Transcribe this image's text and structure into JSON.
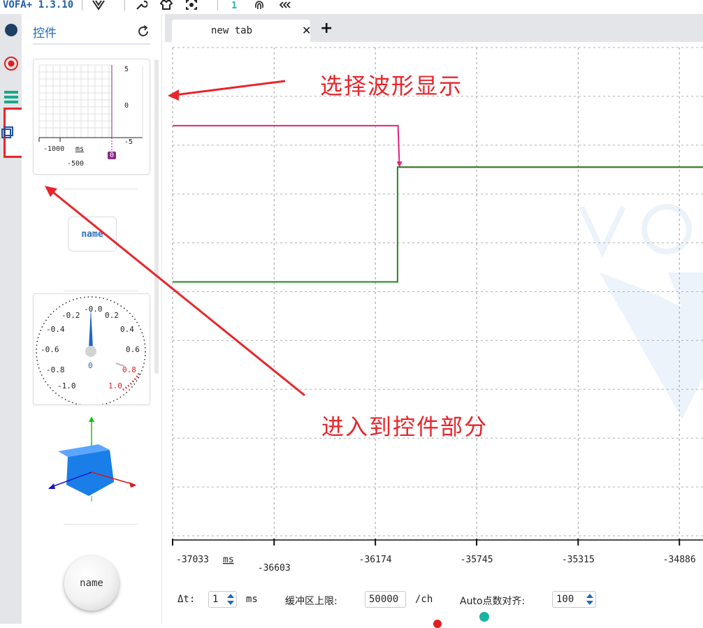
{
  "app": {
    "title": "VOFA+ 1.3.10",
    "toolbar_count": "1"
  },
  "panel": {
    "title": "控件",
    "waveform_widget": {
      "y_top": "5",
      "y_mid": "0",
      "y_bottom": "-5",
      "x_left": "-1000",
      "x_unit": "ms",
      "x_mid": "-500",
      "badge": "0"
    },
    "label_widget": {
      "text": "name"
    },
    "gauge_widget": {
      "ticks_left": [
        "-0.2",
        "-0.4",
        "-0.6",
        "-0.8",
        "-1.0"
      ],
      "ticks_right": [
        "0.2",
        "0.4",
        "0.6",
        "0.8",
        "1.0"
      ],
      "tick_top": "-0.0",
      "value": "0"
    },
    "button_widget": {
      "text": "name"
    }
  },
  "tabs": [
    {
      "label": "new tab",
      "active": true
    }
  ],
  "bottom": {
    "dt_label": "Δt:",
    "dt_value": "1",
    "dt_unit": "ms",
    "buffer_label": "缓冲区上限:",
    "buffer_value": "50000",
    "buffer_unit": "/ch",
    "auto_label": "Auto点数对齐:",
    "auto_value": "100"
  },
  "annotations": {
    "select_waveform": "选择波形显示",
    "enter_widgets": "进入到控件部分"
  },
  "colors": {
    "accent": "#1e68c0",
    "series_pink": "#e0207a",
    "series_green": "#1f8a1f",
    "annotation_red": "#e8252b"
  },
  "chart_data": {
    "type": "line",
    "x_unit": "ms",
    "x_ticks": [
      "-37033",
      "-36603",
      "-36174",
      "-35745",
      "-35315",
      "-34886"
    ],
    "x_tick_values": [
      -37033,
      -36603,
      -36174,
      -35745,
      -35315,
      -34886
    ],
    "xlim": [
      -37033,
      -34786
    ],
    "ylim": [
      0,
      1
    ],
    "grid": true,
    "series": [
      {
        "color": "#e0207a",
        "x": [
          -37033,
          -36078,
          -36072,
          -34786
        ],
        "y": [
          0.84,
          0.84,
          0.755,
          0.755
        ]
      },
      {
        "color": "#1f8a1f",
        "x": [
          -37033,
          -36080,
          -36080,
          -34786
        ],
        "y": [
          0.52,
          0.52,
          0.755,
          0.755
        ]
      }
    ]
  }
}
